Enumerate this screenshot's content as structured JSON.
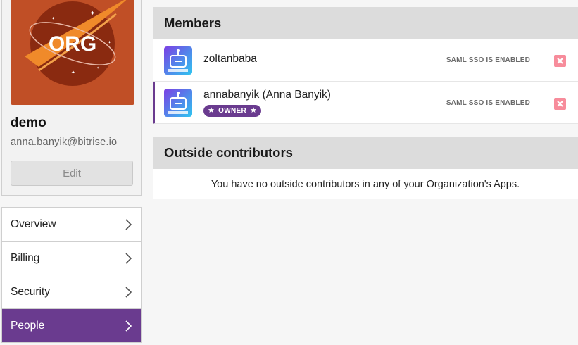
{
  "org": {
    "logo_text": "ORG",
    "name": "demo",
    "email": "anna.banyik@bitrise.io",
    "edit_label": "Edit"
  },
  "nav": {
    "items": [
      {
        "label": "Overview",
        "active": false
      },
      {
        "label": "Billing",
        "active": false
      },
      {
        "label": "Security",
        "active": false
      },
      {
        "label": "People",
        "active": true
      }
    ]
  },
  "members": {
    "title": "Members",
    "rows": [
      {
        "name": "zoltanbaba",
        "sso_status": "SAML SSO IS ENABLED",
        "owner": false
      },
      {
        "name": "annabanyik (Anna Banyik)",
        "sso_status": "SAML SSO IS ENABLED",
        "owner": true,
        "badge": "OWNER"
      }
    ]
  },
  "outside": {
    "title": "Outside contributors",
    "empty_message": "You have no outside contributors in any of your Organization's Apps."
  },
  "colors": {
    "accent": "#6a3b8f",
    "logo_bg": "#c04f26",
    "remove": "#f78c9b"
  }
}
